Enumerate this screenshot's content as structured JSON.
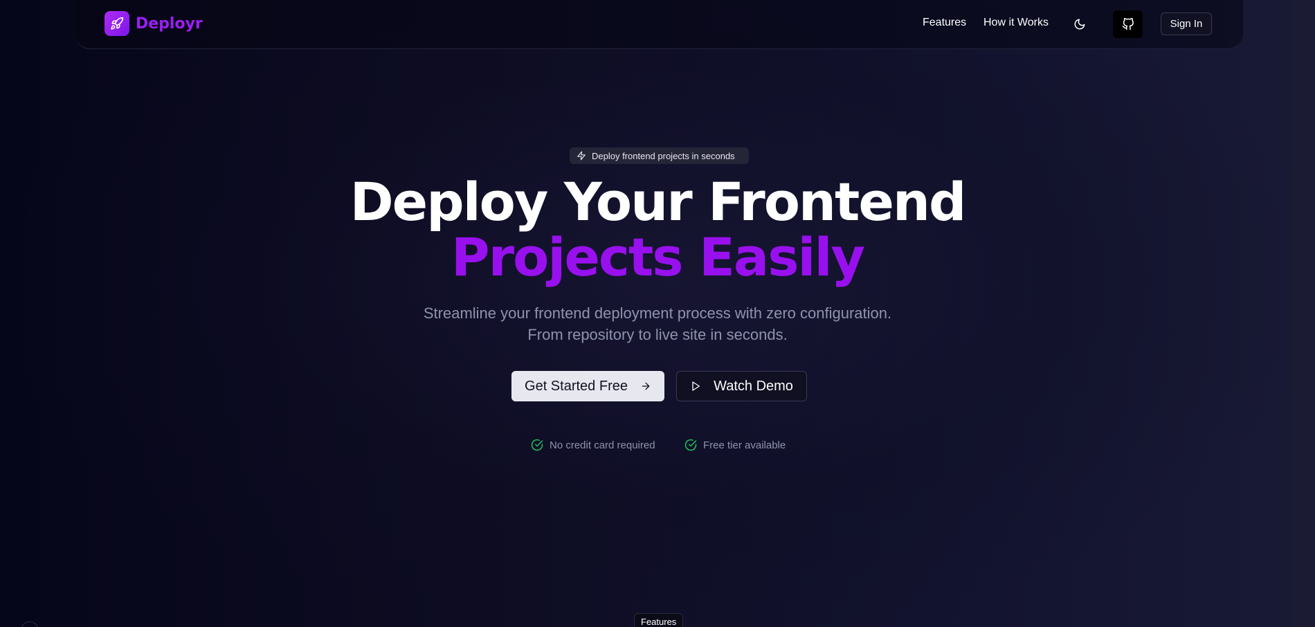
{
  "brand": {
    "name": "Deployr",
    "logo_icon": "rocket-icon",
    "accent_color": "#9b1ef2"
  },
  "nav": {
    "links": [
      {
        "label": "Features"
      },
      {
        "label": "How it Works"
      }
    ],
    "theme_toggle_icon": "moon-icon",
    "github_icon": "github-icon",
    "signin_label": "Sign In"
  },
  "hero": {
    "badge": {
      "icon": "zap-icon",
      "text": "Deploy frontend projects in seconds"
    },
    "title_line1": "Deploy Your Frontend",
    "title_line2": "Projects Easily",
    "title_highlight_color": "#9910ef",
    "subtitle_line1": "Streamline your frontend deployment process with zero configuration.",
    "subtitle_line2": "From repository to live site in seconds.",
    "primary_button": {
      "label": "Get Started Free",
      "icon": "arrow-right-icon"
    },
    "secondary_button": {
      "label": "Watch Demo",
      "icon": "play-icon"
    },
    "perks": [
      {
        "icon": "check-circle-icon",
        "text": "No credit card required"
      },
      {
        "icon": "check-circle-icon",
        "text": "Free tier available"
      }
    ],
    "perk_icon_color": "#22c55e"
  },
  "features_section": {
    "tag": "Features"
  }
}
